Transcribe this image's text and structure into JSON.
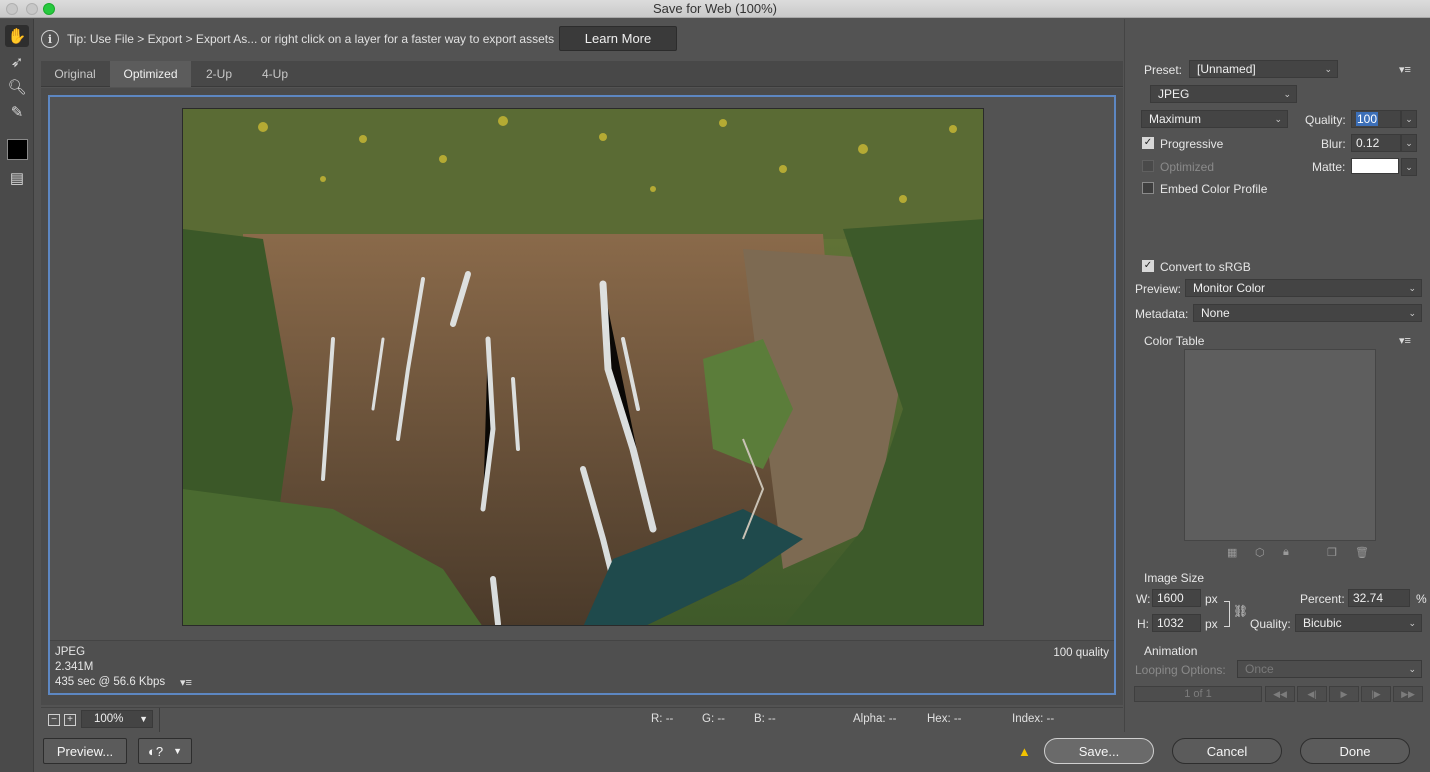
{
  "window": {
    "title": "Save for Web (100%)"
  },
  "tip": {
    "text": "Tip: Use File > Export > Export As...  or right click on a layer for a faster way to export assets",
    "learn_more": "Learn More"
  },
  "tabs": [
    {
      "label": "Original"
    },
    {
      "label": "Optimized"
    },
    {
      "label": "2-Up"
    },
    {
      "label": "4-Up"
    }
  ],
  "preview_info": {
    "format": "JPEG",
    "size": "2.341M",
    "speed": "435 sec @ 56.6 Kbps",
    "quality_label": "100 quality"
  },
  "status": {
    "zoom": "100%",
    "r": "R: --",
    "g": "G: --",
    "b": "B: --",
    "alpha": "Alpha: --",
    "hex": "Hex: --",
    "index": "Index: --"
  },
  "buttons": {
    "preview": "Preview...",
    "save": "Save...",
    "cancel": "Cancel",
    "done": "Done"
  },
  "settings": {
    "preset_label": "Preset:",
    "preset_value": "[Unnamed]",
    "format": "JPEG",
    "compression": "Maximum",
    "quality_label": "Quality:",
    "quality_value": "100",
    "progressive": "Progressive",
    "blur_label": "Blur:",
    "blur_value": "0.12",
    "optimized": "Optimized",
    "matte_label": "Matte:",
    "embed_profile": "Embed Color Profile",
    "convert_srgb": "Convert to sRGB",
    "preview_label": "Preview:",
    "preview_value": "Monitor Color",
    "metadata_label": "Metadata:",
    "metadata_value": "None",
    "color_table": "Color Table"
  },
  "image_size": {
    "title": "Image Size",
    "w_label": "W:",
    "w_value": "1600",
    "h_label": "H:",
    "h_value": "1032",
    "unit": "px",
    "percent_label": "Percent:",
    "percent_value": "32.74",
    "percent_unit": "%",
    "quality_label": "Quality:",
    "quality_value": "Bicubic"
  },
  "animation": {
    "title": "Animation",
    "looping_label": "Looping Options:",
    "looping_value": "Once",
    "frame_counter": "1 of 1"
  },
  "colors": {
    "accent": "#5d87c2",
    "background": "#535353",
    "warning": "#f2c200"
  }
}
